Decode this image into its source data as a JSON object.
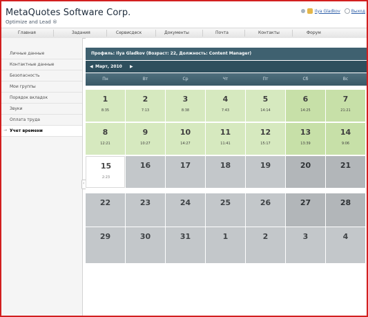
{
  "header": {
    "title": "MetaQuotes Software Corp.",
    "tagline": "Optimize and Lead ®",
    "user_name": "Ilya Gladkov",
    "logout_label": "Выход"
  },
  "nav": {
    "tabs": [
      "Главная",
      "Задания",
      "Сервисдеск",
      "Документы",
      "Почта",
      "Контакты",
      "Форум"
    ]
  },
  "sidebar": {
    "items": [
      {
        "label": "Личные данные"
      },
      {
        "label": "Контактные данные"
      },
      {
        "label": "Безопасность"
      },
      {
        "label": "Мои группы"
      },
      {
        "label": "Порядок вкладок"
      },
      {
        "label": "Звуки"
      },
      {
        "label": "Оплата труда"
      },
      {
        "label": "Учет времени"
      }
    ]
  },
  "profile": {
    "text": "Профиль: Ilya Gladkov (Возраст: 22, Должность: Content Manager)"
  },
  "calendar": {
    "prev_arrow": "◀",
    "month": "Март, 2010",
    "next_arrow": "▶",
    "weekdays": [
      "Пн",
      "Вт",
      "Ср",
      "Чт",
      "Пт",
      "Сб",
      "Вс"
    ],
    "weeks": [
      [
        {
          "day": "1",
          "time": "8:35"
        },
        {
          "day": "2",
          "time": "7:13"
        },
        {
          "day": "3",
          "time": "8:38"
        },
        {
          "day": "4",
          "time": "7:43"
        },
        {
          "day": "5",
          "time": "14:14"
        },
        {
          "day": "6",
          "time": "14:25"
        },
        {
          "day": "7",
          "time": "21:21"
        }
      ],
      [
        {
          "day": "8",
          "time": "12:21"
        },
        {
          "day": "9",
          "time": "10:27"
        },
        {
          "day": "10",
          "time": "14:27"
        },
        {
          "day": "11",
          "time": "11:41"
        },
        {
          "day": "12",
          "time": "15:17"
        },
        {
          "day": "13",
          "time": "13:39"
        },
        {
          "day": "14",
          "time": "9:06"
        }
      ],
      [
        {
          "day": "15",
          "time": "2:23"
        },
        {
          "day": "16",
          "time": ""
        },
        {
          "day": "17",
          "time": ""
        },
        {
          "day": "18",
          "time": ""
        },
        {
          "day": "19",
          "time": ""
        },
        {
          "day": "20",
          "time": ""
        },
        {
          "day": "21",
          "time": ""
        }
      ],
      [
        {
          "day": "22",
          "time": ""
        },
        {
          "day": "23",
          "time": ""
        },
        {
          "day": "24",
          "time": ""
        },
        {
          "day": "25",
          "time": ""
        },
        {
          "day": "26",
          "time": ""
        },
        {
          "day": "27",
          "time": ""
        },
        {
          "day": "28",
          "time": ""
        }
      ],
      [
        {
          "day": "29",
          "time": ""
        },
        {
          "day": "30",
          "time": ""
        },
        {
          "day": "31",
          "time": ""
        },
        {
          "day": "1",
          "time": ""
        },
        {
          "day": "2",
          "time": ""
        },
        {
          "day": "3",
          "time": ""
        },
        {
          "day": "4",
          "time": ""
        }
      ]
    ]
  },
  "colors": {
    "accent_border": "#d21f1f",
    "profile_bar": "#3f6170",
    "worked_day": "#d6e9bf",
    "future_day": "#c3c7ca",
    "weekend_future": "#b2b6b9"
  }
}
